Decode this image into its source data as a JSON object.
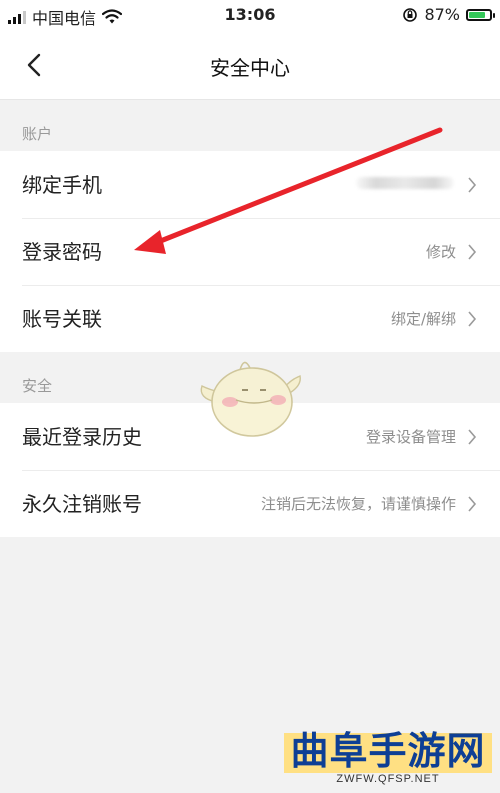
{
  "status_bar": {
    "carrier": "中国电信",
    "time": "13:06",
    "battery_percent": "87%",
    "battery_level": 0.87,
    "icons": [
      "signal-icon",
      "wifi-icon",
      "orientation-lock-icon",
      "battery-charging-icon"
    ]
  },
  "nav": {
    "title": "安全中心",
    "back_icon": "chevron-left-icon"
  },
  "sections": {
    "account": {
      "label": "账户",
      "rows": [
        {
          "label": "绑定手机",
          "value": "",
          "value_masked": true
        },
        {
          "label": "登录密码",
          "value": "修改"
        },
        {
          "label": "账号关联",
          "value": "绑定/解绑"
        }
      ]
    },
    "security": {
      "label": "安全",
      "rows": [
        {
          "label": "最近登录历史",
          "value": "登录设备管理"
        },
        {
          "label": "永久注销账号",
          "value": "注销后无法恢复，请谨慎操作"
        }
      ]
    }
  },
  "annotation": {
    "arrow_color": "#e8242b"
  },
  "watermark": {
    "title": "曲阜手游网",
    "url": "ZWFW.QFSP.NET",
    "title_color": "#0e3f95",
    "bg_color": "#ffe083"
  },
  "colors": {
    "page_bg": "#f2f2f2",
    "card_bg": "#ffffff",
    "secondary_text": "#8e8e8e",
    "battery_green": "#34c759"
  }
}
